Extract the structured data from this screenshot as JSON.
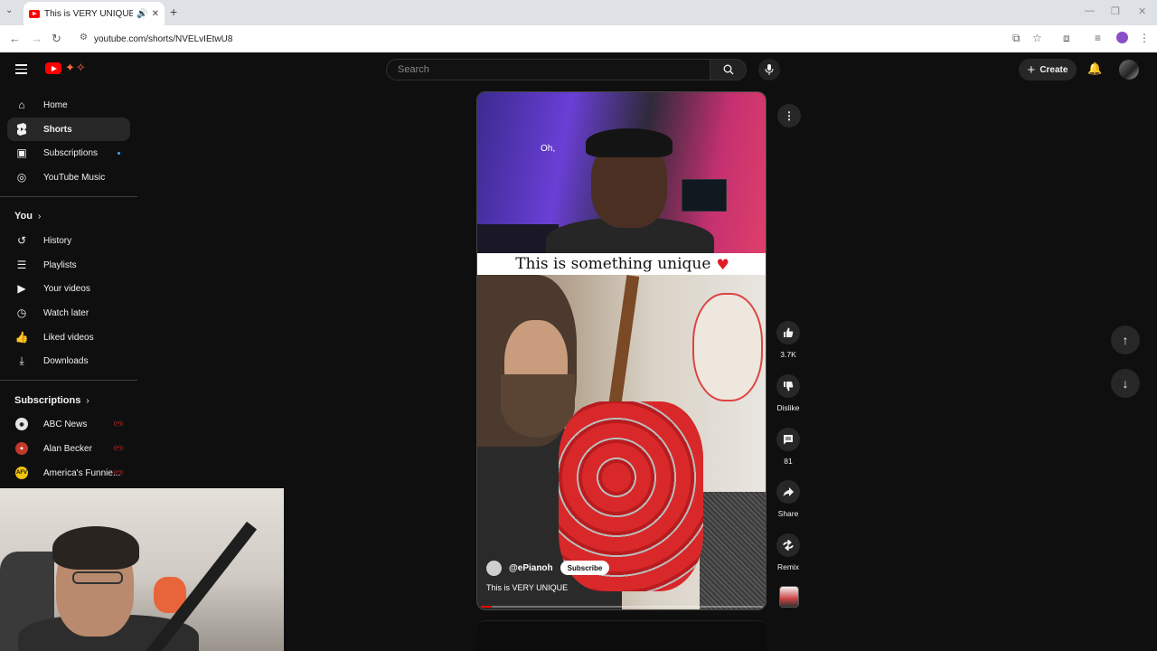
{
  "browser": {
    "tab_title": "This is VERY UNIQUE - YouT",
    "url": "youtube.com/shorts/NVELvIEtwU8"
  },
  "header": {
    "search_placeholder": "Search",
    "create_label": "Create"
  },
  "sidebar": {
    "main_items": [
      {
        "label": "Home",
        "icon": "home-icon"
      },
      {
        "label": "Shorts",
        "icon": "shorts-icon"
      },
      {
        "label": "Subscriptions",
        "icon": "subscriptions-icon"
      },
      {
        "label": "YouTube Music",
        "icon": "music-icon"
      }
    ],
    "you_heading": "You",
    "you_items": [
      {
        "label": "History",
        "icon": "history-icon"
      },
      {
        "label": "Playlists",
        "icon": "playlists-icon"
      },
      {
        "label": "Your videos",
        "icon": "your-videos-icon"
      },
      {
        "label": "Watch later",
        "icon": "watch-later-icon"
      },
      {
        "label": "Liked videos",
        "icon": "liked-icon"
      },
      {
        "label": "Downloads",
        "icon": "downloads-icon"
      }
    ],
    "subscriptions_heading": "Subscriptions",
    "channels": [
      {
        "label": "ABC News",
        "avatar_color": "#e6e6e6"
      },
      {
        "label": "Alan Becker",
        "avatar_color": "#c0392b"
      },
      {
        "label": "America's Funnie...",
        "avatar_color": "#f1c40f",
        "avatar_text": "AFV"
      }
    ]
  },
  "short": {
    "caption": "Oh,",
    "overlay_title": "This is something unique",
    "channel": "@ePianoh",
    "subscribe_label": "Subscribe",
    "title": "This is VERY UNIQUE",
    "progress": 0.04
  },
  "actions": {
    "likes": "3.7K",
    "dislike_label": "Dislike",
    "comments": "81",
    "share_label": "Share",
    "remix_label": "Remix"
  },
  "colors": {
    "brand_red": "#ff0000",
    "background": "#0f0f0f",
    "button_bg": "#272727",
    "unread_dot": "#3ea6ff"
  }
}
